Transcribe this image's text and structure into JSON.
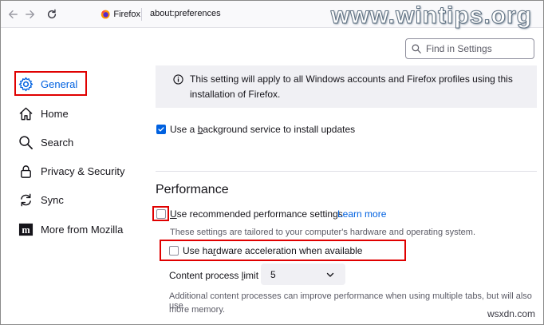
{
  "browser": {
    "identity_label": "Firefox",
    "url": "about:preferences",
    "watermark": "www.wintips.org",
    "search_placeholder": "Find in Settings"
  },
  "sidebar": {
    "items": [
      {
        "label": "General",
        "icon": "gear-icon",
        "active": true
      },
      {
        "label": "Home",
        "icon": "home-icon"
      },
      {
        "label": "Search",
        "icon": "search-icon"
      },
      {
        "label": "Privacy & Security",
        "icon": "lock-icon"
      },
      {
        "label": "Sync",
        "icon": "sync-icon"
      },
      {
        "label": "More from Mozilla",
        "icon": "mozilla-icon"
      }
    ]
  },
  "updates": {
    "info_text": "This setting will apply to all Windows accounts and Firefox profiles using this installation of Firefox.",
    "background_service": {
      "label_pre": "Use a ",
      "label_accesskey": "b",
      "label_post": "ackground service to install updates",
      "checked": true
    }
  },
  "performance": {
    "title": "Performance",
    "recommended": {
      "label_pre": "",
      "label_accesskey": "U",
      "label_post": "se recommended performance settings",
      "checked": false
    },
    "learn_more": "Learn more",
    "recommended_desc": "These settings are tailored to your computer's hardware and operating system.",
    "hardware_accel": {
      "label_pre": "Use ha",
      "label_accesskey": "r",
      "label_post": "dware acceleration when available",
      "checked": false
    },
    "content_process": {
      "label_pre": "Content process ",
      "label_accesskey": "l",
      "label_post": "imit",
      "value": "5"
    },
    "content_process_desc_line1": "Additional content processes can improve performance when using multiple tabs, but will also use",
    "content_process_desc_line2": "more memory."
  },
  "footer_watermark": "wsxdn.com",
  "colors": {
    "accent": "#0061e0",
    "highlight_box": "#e00000",
    "panel": "#f0f0f4"
  }
}
